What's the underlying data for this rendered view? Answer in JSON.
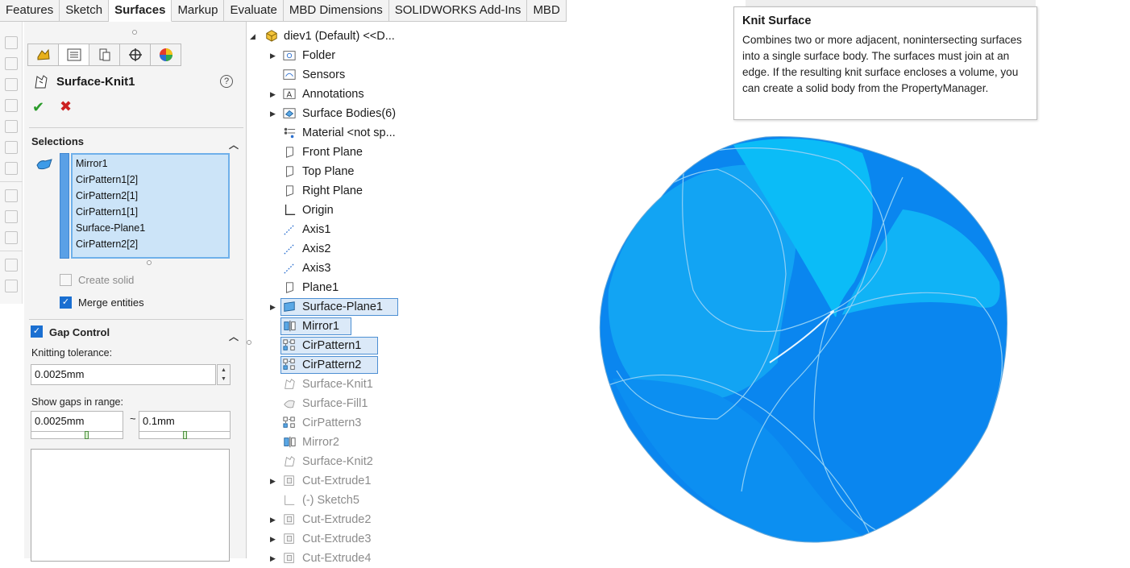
{
  "command_tabs": [
    "Features",
    "Sketch",
    "Surfaces",
    "Markup",
    "Evaluate",
    "MBD Dimensions",
    "SOLIDWORKS Add-Ins",
    "MBD"
  ],
  "active_tab": "Surfaces",
  "property_manager": {
    "title": "Surface-Knit1",
    "help": "?",
    "ok": "✔",
    "cancel": "✖",
    "selections": {
      "header": "Selections",
      "items": [
        "Mirror1",
        "CirPattern1[2]",
        "CirPattern2[1]",
        "CirPattern1[1]",
        "Surface-Plane1",
        "CirPattern2[2]"
      ],
      "create_solid_label": "Create solid",
      "create_solid_checked": false,
      "merge_entities_label": "Merge entities",
      "merge_entities_checked": true
    },
    "gap_control": {
      "header": "Gap Control",
      "enabled": true,
      "tolerance_label": "Knitting tolerance:",
      "tolerance_value": "0.0025mm",
      "show_gaps_label": "Show gaps in range:",
      "range_min": "0.0025mm",
      "range_sep": "~",
      "range_max": "0.1mm"
    }
  },
  "feature_tree": {
    "root": "diev1 (Default) <<D...",
    "items": [
      {
        "label": "Folder",
        "icon": "folder-icon",
        "expandable": true,
        "state": "normal"
      },
      {
        "label": "Sensors",
        "icon": "sensors-icon",
        "expandable": false,
        "state": "normal"
      },
      {
        "label": "Annotations",
        "icon": "annotations-icon",
        "expandable": true,
        "state": "normal"
      },
      {
        "label": "Surface Bodies(6)",
        "icon": "surface-bodies-icon",
        "expandable": true,
        "state": "normal"
      },
      {
        "label": "Material <not sp...",
        "icon": "material-icon",
        "expandable": false,
        "state": "normal"
      },
      {
        "label": "Front Plane",
        "icon": "plane-icon",
        "expandable": false,
        "state": "normal"
      },
      {
        "label": "Top Plane",
        "icon": "plane-icon",
        "expandable": false,
        "state": "normal"
      },
      {
        "label": "Right Plane",
        "icon": "plane-icon",
        "expandable": false,
        "state": "normal"
      },
      {
        "label": "Origin",
        "icon": "origin-icon",
        "expandable": false,
        "state": "normal"
      },
      {
        "label": "Axis1",
        "icon": "axis-icon",
        "expandable": false,
        "state": "normal"
      },
      {
        "label": "Axis2",
        "icon": "axis-icon",
        "expandable": false,
        "state": "normal"
      },
      {
        "label": "Axis3",
        "icon": "axis-icon",
        "expandable": false,
        "state": "normal"
      },
      {
        "label": "Plane1",
        "icon": "plane-icon",
        "expandable": false,
        "state": "normal"
      },
      {
        "label": "Surface-Plane1",
        "icon": "surface-plane-icon",
        "expandable": true,
        "state": "selected"
      },
      {
        "label": "Mirror1",
        "icon": "mirror-icon",
        "expandable": false,
        "state": "selected"
      },
      {
        "label": "CirPattern1",
        "icon": "circular-pattern-icon",
        "expandable": false,
        "state": "selected"
      },
      {
        "label": "CirPattern2",
        "icon": "circular-pattern-icon",
        "expandable": false,
        "state": "selected"
      },
      {
        "label": "Surface-Knit1",
        "icon": "surface-knit-icon",
        "expandable": false,
        "state": "suppressed"
      },
      {
        "label": "Surface-Fill1",
        "icon": "surface-fill-icon",
        "expandable": false,
        "state": "suppressed"
      },
      {
        "label": "CirPattern3",
        "icon": "circular-pattern-icon",
        "expandable": false,
        "state": "suppressed"
      },
      {
        "label": "Mirror2",
        "icon": "mirror-icon",
        "expandable": false,
        "state": "suppressed"
      },
      {
        "label": "Surface-Knit2",
        "icon": "surface-knit-icon",
        "expandable": false,
        "state": "suppressed"
      },
      {
        "label": "Cut-Extrude1",
        "icon": "cut-extrude-icon",
        "expandable": true,
        "state": "suppressed"
      },
      {
        "label": "(-) Sketch5",
        "icon": "sketch-icon",
        "expandable": false,
        "state": "suppressed"
      },
      {
        "label": "Cut-Extrude2",
        "icon": "cut-extrude-icon",
        "expandable": true,
        "state": "suppressed"
      },
      {
        "label": "Cut-Extrude3",
        "icon": "cut-extrude-icon",
        "expandable": true,
        "state": "suppressed"
      },
      {
        "label": "Cut-Extrude4",
        "icon": "cut-extrude-icon",
        "expandable": true,
        "state": "suppressed"
      }
    ]
  },
  "tooltip": {
    "title": "Knit Surface",
    "body": "Combines two or more adjacent, nonintersecting surfaces into a single surface body. The surfaces must join at an edge. If the resulting knit surface encloses a volume, you can create a solid body from the PropertyManager."
  },
  "colors": {
    "accent": "#1a6fd1",
    "selection_fill": "#cce4f8",
    "model_light": "#0bbcf7",
    "model_mid": "#12a4f3",
    "model_dark": "#0a86ef"
  }
}
